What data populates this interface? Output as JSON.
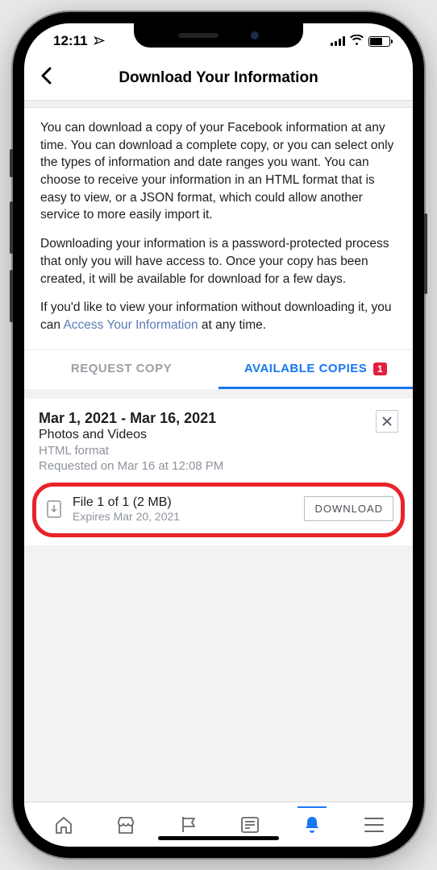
{
  "status": {
    "time": "12:11"
  },
  "header": {
    "title": "Download Your Information"
  },
  "intro": {
    "p1": "You can download a copy of your Facebook information at any time. You can download a complete copy, or you can select only the types of information and date ranges you want. You can choose to receive your information in an HTML format that is easy to view, or a JSON format, which could allow another service to more easily import it.",
    "p2": "Downloading your information is a password-protected process that only you will have access to. Once your copy has been created, it will be available for download for a few days.",
    "p3_pre": "If you'd like to view your information without downloading it, you can ",
    "p3_link": "Access Your Information",
    "p3_post": " at any time."
  },
  "tabs": {
    "request": "REQUEST COPY",
    "available": "AVAILABLE COPIES",
    "badge": "1"
  },
  "copy": {
    "date_range": "Mar 1, 2021 - Mar 16, 2021",
    "category": "Photos and Videos",
    "format": "HTML format",
    "requested": "Requested on Mar 16 at 12:08 PM",
    "file_label": "File 1 of 1 (2 MB)",
    "expires": "Expires Mar 20, 2021",
    "download_btn": "DOWNLOAD"
  }
}
